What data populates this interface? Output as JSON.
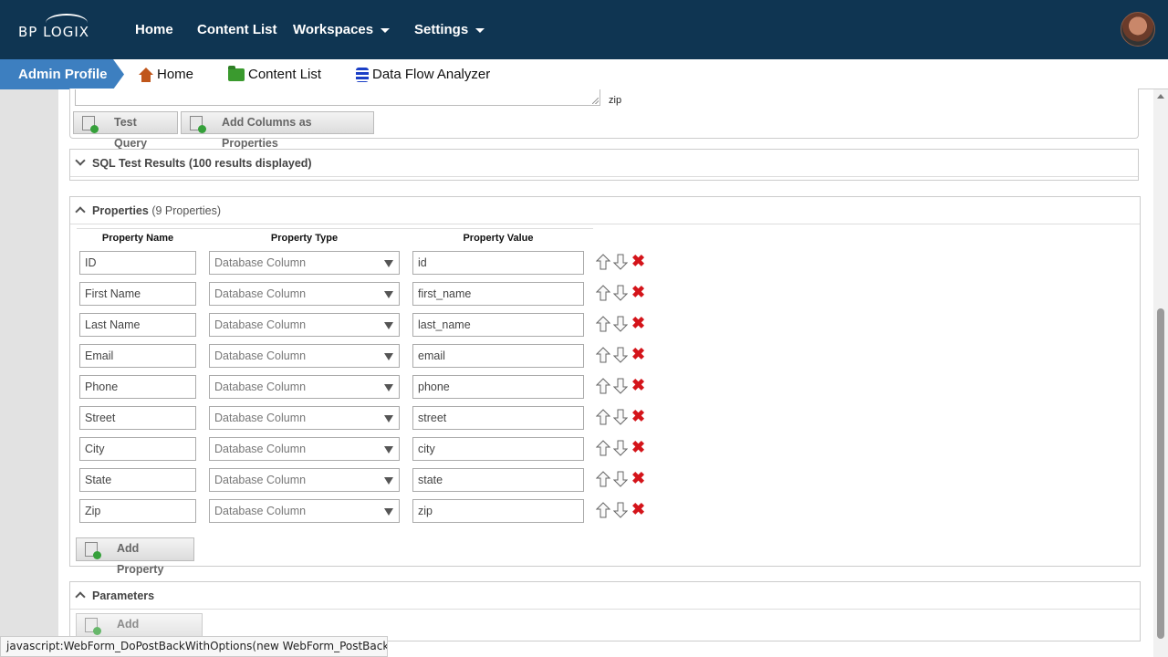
{
  "brand": {
    "logo_text": "BP LOGIX"
  },
  "topnav": {
    "items": [
      {
        "label": "Home"
      },
      {
        "label": "Content List"
      },
      {
        "label": "Workspaces"
      },
      {
        "label": "Settings"
      }
    ]
  },
  "breadcrumb": {
    "profile": "Admin Profile",
    "items": [
      {
        "label": "Home",
        "icon": "home-icon"
      },
      {
        "label": "Content List",
        "icon": "folder-icon"
      },
      {
        "label": "Data Flow Analyzer",
        "icon": "database-icon"
      }
    ]
  },
  "query": {
    "zip_text": "zip",
    "test_query_label": "Test Query",
    "add_columns_label": "Add Columns as Properties"
  },
  "sql_results": {
    "title": "SQL Test Results (100 results displayed)"
  },
  "properties": {
    "title": "Properties",
    "count": "(9 Properties)",
    "columns": [
      "Property Name",
      "Property Type",
      "Property Value"
    ],
    "rows": [
      {
        "name": "ID",
        "type": "Database Column",
        "value": "id"
      },
      {
        "name": "First Name",
        "type": "Database Column",
        "value": "first_name"
      },
      {
        "name": "Last Name",
        "type": "Database Column",
        "value": "last_name"
      },
      {
        "name": "Email",
        "type": "Database Column",
        "value": "email"
      },
      {
        "name": "Phone",
        "type": "Database Column",
        "value": "phone"
      },
      {
        "name": "Street",
        "type": "Database Column",
        "value": "street"
      },
      {
        "name": "City",
        "type": "Database Column",
        "value": "city"
      },
      {
        "name": "State",
        "type": "Database Column",
        "value": "state"
      },
      {
        "name": "Zip",
        "type": "Database Column",
        "value": "zip"
      }
    ],
    "add_label": "Add Property",
    "remove_glyph": "✖"
  },
  "parameters": {
    "title": "Parameters",
    "add_label": "Add Parameter"
  },
  "statusbar": {
    "text": "javascript:WebForm_DoPostBackWithOptions(new WebForm_PostBackOptio..."
  }
}
